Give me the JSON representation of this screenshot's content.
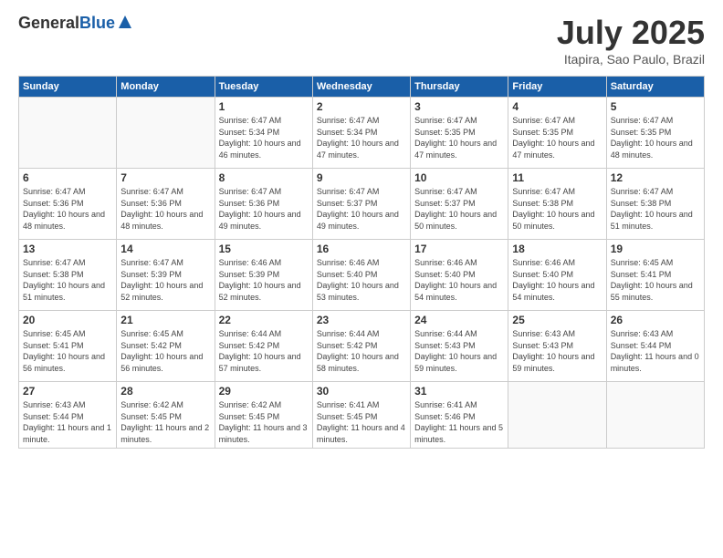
{
  "logo": {
    "general": "General",
    "blue": "Blue"
  },
  "header": {
    "month_title": "July 2025",
    "location": "Itapira, Sao Paulo, Brazil"
  },
  "weekdays": [
    "Sunday",
    "Monday",
    "Tuesday",
    "Wednesday",
    "Thursday",
    "Friday",
    "Saturday"
  ],
  "weeks": [
    [
      {
        "day": "",
        "info": ""
      },
      {
        "day": "",
        "info": ""
      },
      {
        "day": "1",
        "info": "Sunrise: 6:47 AM\nSunset: 5:34 PM\nDaylight: 10 hours and 46 minutes."
      },
      {
        "day": "2",
        "info": "Sunrise: 6:47 AM\nSunset: 5:34 PM\nDaylight: 10 hours and 47 minutes."
      },
      {
        "day": "3",
        "info": "Sunrise: 6:47 AM\nSunset: 5:35 PM\nDaylight: 10 hours and 47 minutes."
      },
      {
        "day": "4",
        "info": "Sunrise: 6:47 AM\nSunset: 5:35 PM\nDaylight: 10 hours and 47 minutes."
      },
      {
        "day": "5",
        "info": "Sunrise: 6:47 AM\nSunset: 5:35 PM\nDaylight: 10 hours and 48 minutes."
      }
    ],
    [
      {
        "day": "6",
        "info": "Sunrise: 6:47 AM\nSunset: 5:36 PM\nDaylight: 10 hours and 48 minutes."
      },
      {
        "day": "7",
        "info": "Sunrise: 6:47 AM\nSunset: 5:36 PM\nDaylight: 10 hours and 48 minutes."
      },
      {
        "day": "8",
        "info": "Sunrise: 6:47 AM\nSunset: 5:36 PM\nDaylight: 10 hours and 49 minutes."
      },
      {
        "day": "9",
        "info": "Sunrise: 6:47 AM\nSunset: 5:37 PM\nDaylight: 10 hours and 49 minutes."
      },
      {
        "day": "10",
        "info": "Sunrise: 6:47 AM\nSunset: 5:37 PM\nDaylight: 10 hours and 50 minutes."
      },
      {
        "day": "11",
        "info": "Sunrise: 6:47 AM\nSunset: 5:38 PM\nDaylight: 10 hours and 50 minutes."
      },
      {
        "day": "12",
        "info": "Sunrise: 6:47 AM\nSunset: 5:38 PM\nDaylight: 10 hours and 51 minutes."
      }
    ],
    [
      {
        "day": "13",
        "info": "Sunrise: 6:47 AM\nSunset: 5:38 PM\nDaylight: 10 hours and 51 minutes."
      },
      {
        "day": "14",
        "info": "Sunrise: 6:47 AM\nSunset: 5:39 PM\nDaylight: 10 hours and 52 minutes."
      },
      {
        "day": "15",
        "info": "Sunrise: 6:46 AM\nSunset: 5:39 PM\nDaylight: 10 hours and 52 minutes."
      },
      {
        "day": "16",
        "info": "Sunrise: 6:46 AM\nSunset: 5:40 PM\nDaylight: 10 hours and 53 minutes."
      },
      {
        "day": "17",
        "info": "Sunrise: 6:46 AM\nSunset: 5:40 PM\nDaylight: 10 hours and 54 minutes."
      },
      {
        "day": "18",
        "info": "Sunrise: 6:46 AM\nSunset: 5:40 PM\nDaylight: 10 hours and 54 minutes."
      },
      {
        "day": "19",
        "info": "Sunrise: 6:45 AM\nSunset: 5:41 PM\nDaylight: 10 hours and 55 minutes."
      }
    ],
    [
      {
        "day": "20",
        "info": "Sunrise: 6:45 AM\nSunset: 5:41 PM\nDaylight: 10 hours and 56 minutes."
      },
      {
        "day": "21",
        "info": "Sunrise: 6:45 AM\nSunset: 5:42 PM\nDaylight: 10 hours and 56 minutes."
      },
      {
        "day": "22",
        "info": "Sunrise: 6:44 AM\nSunset: 5:42 PM\nDaylight: 10 hours and 57 minutes."
      },
      {
        "day": "23",
        "info": "Sunrise: 6:44 AM\nSunset: 5:42 PM\nDaylight: 10 hours and 58 minutes."
      },
      {
        "day": "24",
        "info": "Sunrise: 6:44 AM\nSunset: 5:43 PM\nDaylight: 10 hours and 59 minutes."
      },
      {
        "day": "25",
        "info": "Sunrise: 6:43 AM\nSunset: 5:43 PM\nDaylight: 10 hours and 59 minutes."
      },
      {
        "day": "26",
        "info": "Sunrise: 6:43 AM\nSunset: 5:44 PM\nDaylight: 11 hours and 0 minutes."
      }
    ],
    [
      {
        "day": "27",
        "info": "Sunrise: 6:43 AM\nSunset: 5:44 PM\nDaylight: 11 hours and 1 minute."
      },
      {
        "day": "28",
        "info": "Sunrise: 6:42 AM\nSunset: 5:45 PM\nDaylight: 11 hours and 2 minutes."
      },
      {
        "day": "29",
        "info": "Sunrise: 6:42 AM\nSunset: 5:45 PM\nDaylight: 11 hours and 3 minutes."
      },
      {
        "day": "30",
        "info": "Sunrise: 6:41 AM\nSunset: 5:45 PM\nDaylight: 11 hours and 4 minutes."
      },
      {
        "day": "31",
        "info": "Sunrise: 6:41 AM\nSunset: 5:46 PM\nDaylight: 11 hours and 5 minutes."
      },
      {
        "day": "",
        "info": ""
      },
      {
        "day": "",
        "info": ""
      }
    ]
  ]
}
